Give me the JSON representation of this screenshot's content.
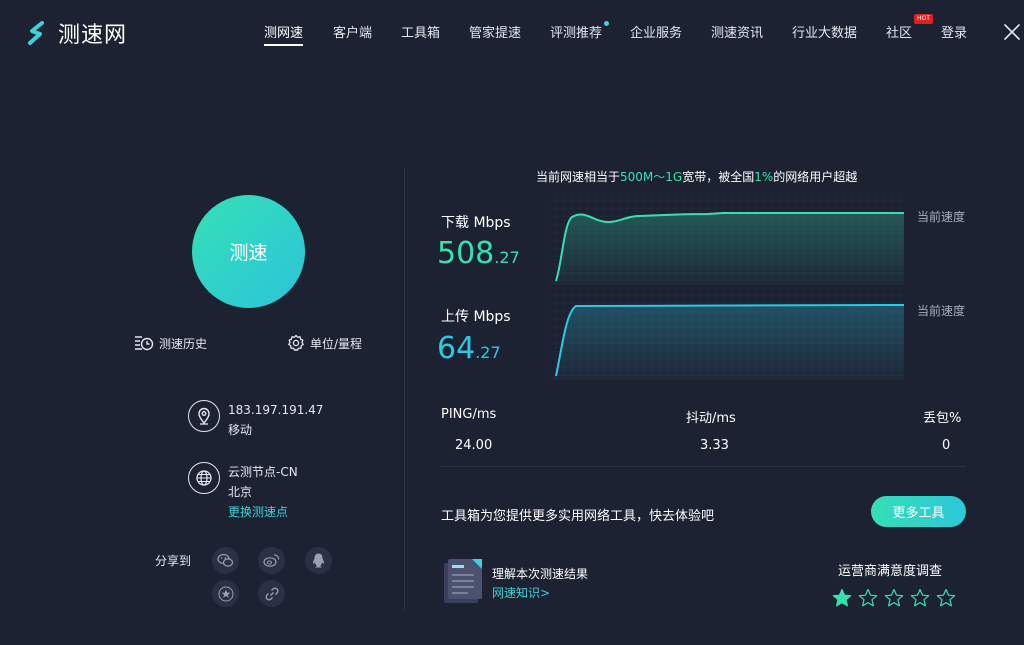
{
  "brand": {
    "name": "测速网"
  },
  "nav": {
    "items": [
      {
        "label": "测网速",
        "active": true
      },
      {
        "label": "客户端"
      },
      {
        "label": "工具箱"
      },
      {
        "label": "管家提速"
      },
      {
        "label": "评测推荐",
        "dot": true
      },
      {
        "label": "企业服务"
      },
      {
        "label": "测速资讯"
      },
      {
        "label": "行业大数据"
      },
      {
        "label": "社区",
        "badge": "HOT"
      },
      {
        "label": "登录"
      }
    ]
  },
  "left": {
    "start_button": "测速",
    "history_label": "测速历史",
    "unit_label": "单位/量程",
    "ip": "183.197.191.47",
    "isp": "移动",
    "node_name": "云测节点-CN",
    "node_city": "北京",
    "change_node_link": "更换测速点",
    "share_label": "分享到"
  },
  "right": {
    "headline": {
      "prefix": "当前网速相当于",
      "bandwidth": "500M～1G",
      "middle": "宽带，被全国",
      "percent": "1%",
      "suffix": "的网络用户超越"
    },
    "download": {
      "label": "下载 Mbps",
      "int": "508",
      "dec": ".27",
      "note": "当前速度"
    },
    "upload": {
      "label": "上传 Mbps",
      "int": "64",
      "dec": ".27",
      "note": "当前速度"
    },
    "stats": {
      "ping_label": "PING/ms",
      "ping_value": "24.00",
      "jitter_label": "抖动/ms",
      "jitter_value": "3.33",
      "loss_label": "丢包%",
      "loss_value": "0"
    },
    "tool_promo": "工具箱为您提供更多实用网络工具，快去体验吧",
    "more_tools_button": "更多工具",
    "doc_title": "理解本次测速结果",
    "doc_link": "网速知识>",
    "survey_title": "运营商满意度调查",
    "rating": {
      "value": 1,
      "max": 5
    }
  },
  "colors": {
    "background": "#1d2233",
    "accent_green": "#38e0b0",
    "accent_cyan": "#2fc8e4",
    "link": "#3fd1d9"
  },
  "icons": {
    "history": "history-clock-icon",
    "unit": "gear-icon",
    "ip": "location-pin-icon",
    "node": "globe-icon",
    "share": [
      "wechat-icon",
      "weibo-icon",
      "qq-icon",
      "favorite-star-icon",
      "link-icon"
    ]
  }
}
